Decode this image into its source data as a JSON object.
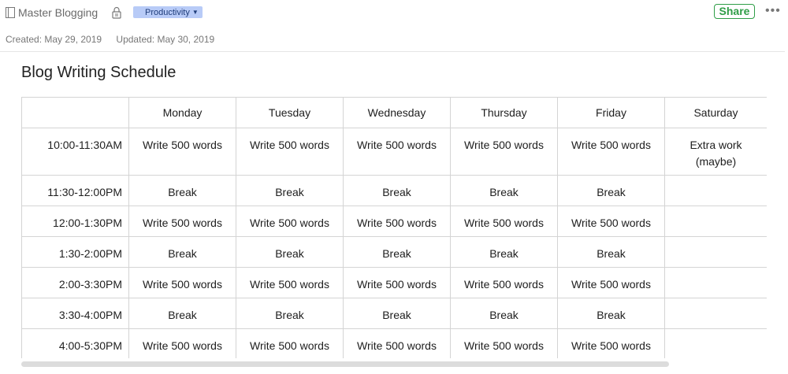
{
  "note": {
    "notebook_name": "Master Blogging",
    "tag_label": "Productivity",
    "share_label": "Share",
    "more_label": "•••",
    "created": "Created: May 29, 2019",
    "updated": "Updated: May 30, 2019",
    "title": "Blog Writing Schedule"
  },
  "colors": {
    "tag_bg": "#b8cbf7",
    "share_green": "#2f9e47"
  },
  "table": {
    "headers": [
      "",
      "Monday",
      "Tuesday",
      "Wednesday",
      "Thursday",
      "Friday",
      "Saturday"
    ],
    "rows": [
      [
        "10:00-11:30AM",
        "Write 500 words",
        "Write 500 words",
        "Write 500 words",
        "Write 500 words",
        "Write 500 words",
        "Extra work (maybe)"
      ],
      [
        "11:30-12:00PM",
        "Break",
        "Break",
        "Break",
        "Break",
        "Break",
        ""
      ],
      [
        "12:00-1:30PM",
        "Write 500 words",
        "Write 500 words",
        "Write 500 words",
        "Write 500 words",
        "Write 500 words",
        ""
      ],
      [
        "1:30-2:00PM",
        "Break",
        "Break",
        "Break",
        "Break",
        "Break",
        ""
      ],
      [
        "2:00-3:30PM",
        "Write 500 words",
        "Write 500 words",
        "Write 500 words",
        "Write 500 words",
        "Write 500 words",
        ""
      ],
      [
        "3:30-4:00PM",
        "Break",
        "Break",
        "Break",
        "Break",
        "Break",
        ""
      ],
      [
        "4:00-5:30PM",
        "Write 500 words",
        "Write 500 words",
        "Write 500 words",
        "Write 500 words",
        "Write 500 words",
        ""
      ]
    ]
  }
}
